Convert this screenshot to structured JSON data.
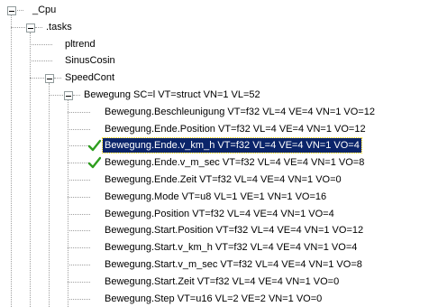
{
  "tree": {
    "nodes": [
      {
        "label": "_Cpu",
        "depth": 0,
        "expanded": true
      },
      {
        "label": ".tasks",
        "depth": 1,
        "expanded": true
      },
      {
        "label": "pltrend",
        "depth": 2
      },
      {
        "label": "SinusCosin",
        "depth": 2
      },
      {
        "label": "SpeedCont",
        "depth": 2,
        "expanded": true
      },
      {
        "label": "Bewegung SC=l VT=struct VN=1 VL=52",
        "depth": 3,
        "expanded": true
      },
      {
        "label": "Bewegung.Beschleunigung VT=f32 VL=4 VE=4 VN=1 VO=12",
        "depth": 4
      },
      {
        "label": "Bewegung.Ende.Position VT=f32 VL=4 VE=4 VN=1 VO=12",
        "depth": 4
      },
      {
        "label": "Bewegung.Ende.v_km_h VT=f32 VL=4 VE=4 VN=1 VO=4",
        "depth": 4,
        "selected": true,
        "checked": true
      },
      {
        "label": "Bewegung.Ende.v_m_sec VT=f32 VL=4 VE=4 VN=1 VO=8",
        "depth": 4,
        "checked": true
      },
      {
        "label": "Bewegung.Ende.Zeit VT=f32 VL=4 VE=4 VN=1 VO=0",
        "depth": 4
      },
      {
        "label": "Bewegung.Mode VT=u8 VL=1 VE=1 VN=1 VO=16",
        "depth": 4
      },
      {
        "label": "Bewegung.Position VT=f32 VL=4 VE=4 VN=1 VO=4",
        "depth": 4
      },
      {
        "label": "Bewegung.Start.Position VT=f32 VL=4 VE=4 VN=1 VO=12",
        "depth": 4
      },
      {
        "label": "Bewegung.Start.v_km_h VT=f32 VL=4 VE=4 VN=1 VO=4",
        "depth": 4
      },
      {
        "label": "Bewegung.Start.v_m_sec VT=f32 VL=4 VE=4 VN=1 VO=8",
        "depth": 4
      },
      {
        "label": "Bewegung.Start.Zeit VT=f32 VL=4 VE=4 VN=1 VO=0",
        "depth": 4
      },
      {
        "label": "Bewegung.Step VT=u16 VL=2 VE=2 VN=1 VO=0",
        "depth": 4
      }
    ],
    "colors": {
      "selection_bg": "#0a246a",
      "selection_text": "#ffffff",
      "check": "#2e9e1e",
      "lines": "#a0a0a0"
    }
  }
}
